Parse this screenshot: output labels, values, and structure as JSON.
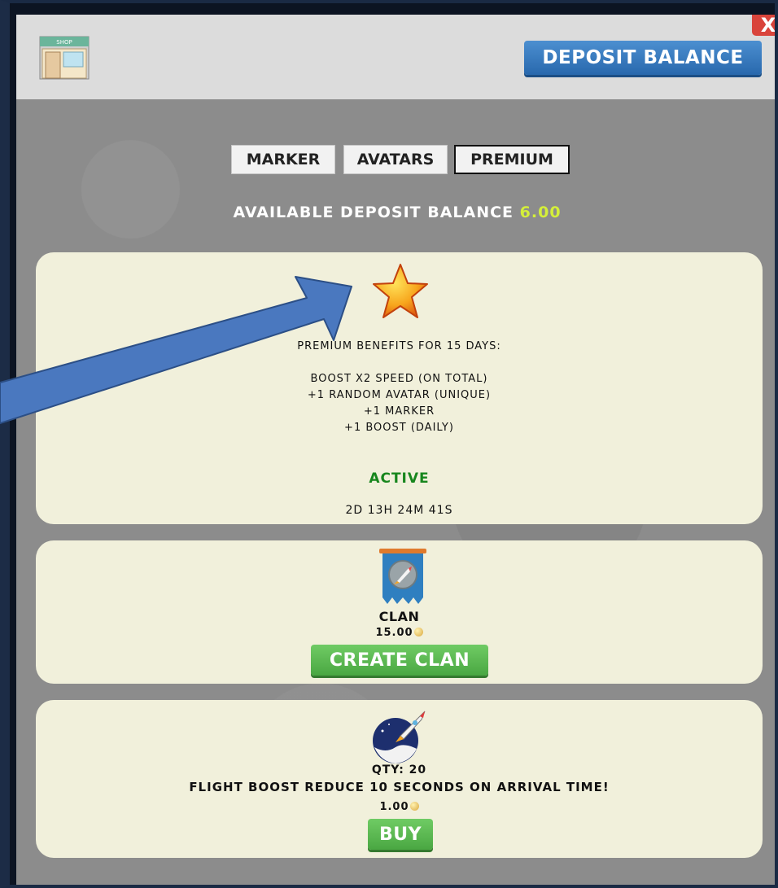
{
  "header": {
    "shop_icon_label": "SHOP",
    "deposit_label": "DEPOSIT BALANCE",
    "close_label": "X"
  },
  "tabs": [
    {
      "label": "MARKER",
      "active": false
    },
    {
      "label": "AVATARS",
      "active": false
    },
    {
      "label": "PREMIUM",
      "active": true
    }
  ],
  "balance": {
    "label": "AVAILABLE DEPOSIT BALANCE",
    "amount": "6.00"
  },
  "premium": {
    "icon": "star-icon",
    "heading": "PREMIUM BENEFITS FOR 15 DAYS:",
    "benefits": [
      "BOOST X2 SPEED (ON TOTAL)",
      "+1 RANDOM AVATAR (UNIQUE)",
      "+1 MARKER",
      "+1 BOOST (DAILY)"
    ],
    "status": "ACTIVE",
    "timer": "2D 13H 24M 41S"
  },
  "clan": {
    "icon": "rocket-banner-icon",
    "title": "CLAN",
    "price": "15.00",
    "button_label": "CREATE CLAN"
  },
  "boost": {
    "icon": "rocket-icon",
    "qty": "QTY: 20",
    "description": "FLIGHT BOOST REDUCE 10 SECONDS ON ARRIVAL TIME!",
    "price": "1.00",
    "button_label": "BUY"
  },
  "colors": {
    "accent_blue": "#2868ad",
    "active_green": "#17861d",
    "balance_yellow": "#d4ef3a",
    "button_green": "#4aa742",
    "close_red": "#d9443b"
  }
}
